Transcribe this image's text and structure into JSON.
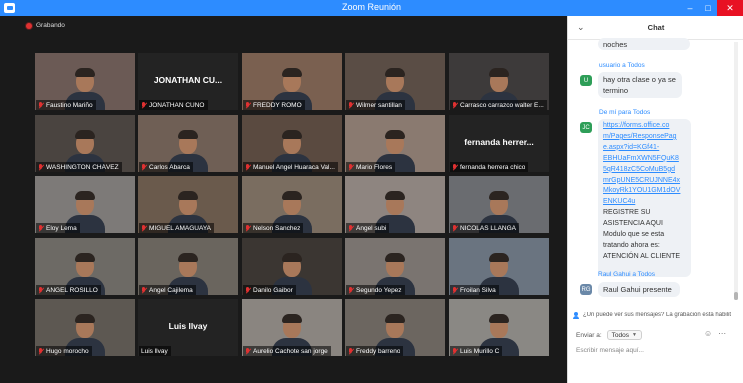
{
  "window": {
    "title": "Zoom Reunión",
    "min": "–",
    "max": "□",
    "close": "✕"
  },
  "meeting": {
    "recording_label": "Grabando"
  },
  "participants": [
    {
      "name": "Faustino Mariño",
      "video": true
    },
    {
      "name": "JONATHAN CUNO",
      "video": false,
      "display": "JONATHAN  CU..."
    },
    {
      "name": "FREDDY ROMO",
      "video": true
    },
    {
      "name": "Wilmer santillan",
      "video": true
    },
    {
      "name": "Carrasco carrazco walter E...",
      "video": true
    },
    {
      "name": "WASHINGTON CHÁVEZ",
      "video": true
    },
    {
      "name": "Carlos Abarca",
      "video": true
    },
    {
      "name": "Manuel Angel Huaraca Val...",
      "video": true
    },
    {
      "name": "Mario Flores",
      "video": true
    },
    {
      "name": "fernanda herrera chico",
      "video": false,
      "display": "fernanda  herrer..."
    },
    {
      "name": "Eloy Lema",
      "video": true
    },
    {
      "name": "MIGUEL AMAGUAYA",
      "video": true
    },
    {
      "name": "Nelson Sanchez",
      "video": true
    },
    {
      "name": "Ángel subi",
      "video": true
    },
    {
      "name": "NICOLAS  LLANGA",
      "video": true
    },
    {
      "name": "ANGEL ROSILLO",
      "video": true
    },
    {
      "name": "Angel Cajilema",
      "video": true
    },
    {
      "name": "Danilo Gaibor",
      "video": true
    },
    {
      "name": "Segundo Yepez",
      "video": true
    },
    {
      "name": "Froilan Silva",
      "video": true
    },
    {
      "name": "Hugo morocho",
      "video": true
    },
    {
      "name": "Luis llvay",
      "video": false,
      "display": "Luis llvay"
    },
    {
      "name": "Aurelio Cachote san jorge",
      "video": true
    },
    {
      "name": "Freddy barreno",
      "video": true
    },
    {
      "name": "Luis Murillo C",
      "video": true
    }
  ],
  "chat": {
    "title": "Chat",
    "collapse_icon": "chevron-down-icon",
    "messages": [
      {
        "text": "noches"
      },
      {
        "sender": "usuario a ",
        "to": "Todos",
        "avatar": "U",
        "text_lines": [
          "hay otra clase o ya se",
          "termino"
        ]
      },
      {
        "sender": "De mí para ",
        "to": "Todos",
        "avatar": "JC",
        "link_lines": [
          "https://forms.office.co",
          "m/Pages/ResponsePag",
          "e.aspx?id=KGf41-",
          "EBHUaFmXWN5FQuK8",
          "5qR418zC5CoMuB5gd",
          "mrGpUNE5CRUJNNE4x",
          "MkoyRk1YOU1GM1dOV",
          "ENKUC4u"
        ],
        "text_lines": [
          "REGISTRE SU",
          "ASISTENCIA AQUI",
          "Modulo que se esta",
          "tratando ahora es:",
          "ATENCIÓN AL CLIENTE"
        ]
      },
      {
        "sender": "Raul Gahui a ",
        "to": "Todos",
        "avatar": "RG",
        "text": "Raul  Gahui presente"
      }
    ],
    "notice": "¿Un puede ver sus mensajes? La grabación está habilit",
    "send_to_label": "Enviar a:",
    "send_to_value": "Todos",
    "input_placeholder": "Escribir mensaje aquí..."
  },
  "colors": {
    "titlebar": "#2d8cff",
    "active_speaker": "#c9dd2a",
    "muted": "#e03131",
    "chat_link": "#2d8cff"
  }
}
